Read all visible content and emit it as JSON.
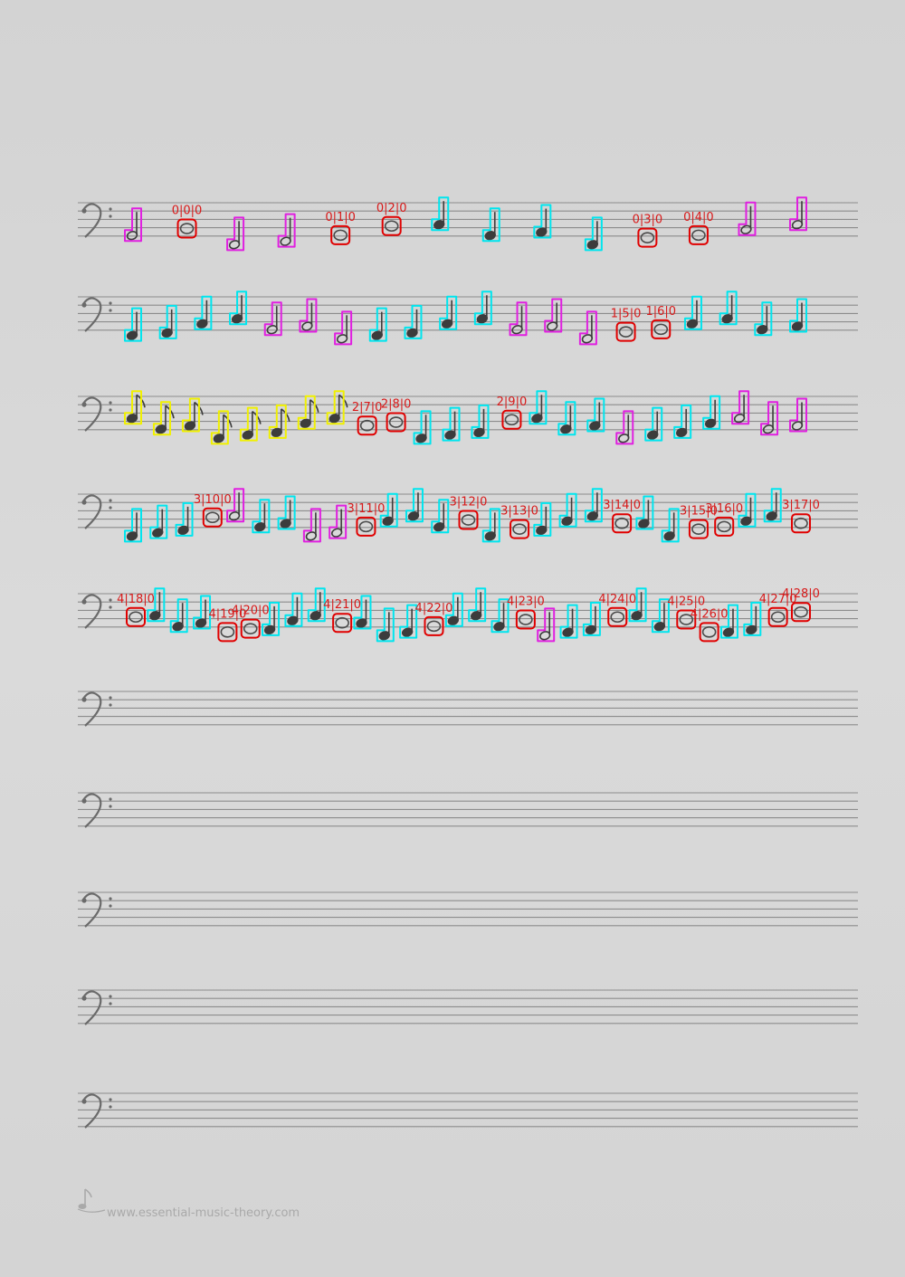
{
  "colors": {
    "paper": "#d6d6d6",
    "staff_line": "#8c8c8c",
    "note_ink": "#3c3c3c",
    "whole_box": "#e00000",
    "half_box": "#e020e0",
    "quarter_box": "#00e5ee",
    "eighth_box": "#f0f000",
    "label": "#d81a1a"
  },
  "footer": {
    "logo_icon": "eighth-note-icon",
    "url": "www.essential-music-theory.com"
  },
  "staves": [
    {
      "notes": [
        {
          "t": "half",
          "label": ""
        },
        {
          "t": "whole",
          "label": "0|0|0"
        },
        {
          "t": "half",
          "label": ""
        },
        {
          "t": "half",
          "label": ""
        },
        {
          "t": "whole",
          "label": "0|1|0"
        },
        {
          "t": "whole",
          "label": "0|2|0"
        },
        {
          "t": "quarter",
          "label": ""
        },
        {
          "t": "quarter",
          "label": ""
        },
        {
          "t": "quarter",
          "label": ""
        },
        {
          "t": "quarter",
          "label": ""
        },
        {
          "t": "whole",
          "label": "0|3|0"
        },
        {
          "t": "whole",
          "label": "0|4|0"
        },
        {
          "t": "half",
          "label": ""
        },
        {
          "t": "half",
          "label": ""
        }
      ]
    },
    {
      "notes": [
        {
          "t": "quarter",
          "label": ""
        },
        {
          "t": "quarter",
          "label": ""
        },
        {
          "t": "quarter",
          "label": ""
        },
        {
          "t": "quarter",
          "label": ""
        },
        {
          "t": "half",
          "label": ""
        },
        {
          "t": "half",
          "label": ""
        },
        {
          "t": "half",
          "label": ""
        },
        {
          "t": "quarter",
          "label": ""
        },
        {
          "t": "quarter",
          "label": ""
        },
        {
          "t": "quarter",
          "label": ""
        },
        {
          "t": "quarter",
          "label": ""
        },
        {
          "t": "half",
          "label": ""
        },
        {
          "t": "half",
          "label": ""
        },
        {
          "t": "half",
          "label": ""
        },
        {
          "t": "whole",
          "label": "1|5|0"
        },
        {
          "t": "whole",
          "label": "1|6|0"
        },
        {
          "t": "quarter",
          "label": ""
        },
        {
          "t": "quarter",
          "label": ""
        },
        {
          "t": "quarter",
          "label": ""
        },
        {
          "t": "quarter",
          "label": ""
        }
      ]
    },
    {
      "notes": [
        {
          "t": "eighth",
          "label": ""
        },
        {
          "t": "eighth",
          "label": ""
        },
        {
          "t": "eighth",
          "label": ""
        },
        {
          "t": "eighth",
          "label": ""
        },
        {
          "t": "eighth",
          "label": ""
        },
        {
          "t": "eighth",
          "label": ""
        },
        {
          "t": "eighth",
          "label": ""
        },
        {
          "t": "eighth",
          "label": ""
        },
        {
          "t": "whole",
          "label": "2|7|0"
        },
        {
          "t": "whole",
          "label": "2|8|0"
        },
        {
          "t": "quarter",
          "label": ""
        },
        {
          "t": "quarter",
          "label": ""
        },
        {
          "t": "quarter",
          "label": ""
        },
        {
          "t": "whole",
          "label": "2|9|0"
        },
        {
          "t": "quarter",
          "label": ""
        },
        {
          "t": "quarter",
          "label": ""
        },
        {
          "t": "quarter",
          "label": ""
        },
        {
          "t": "half",
          "label": ""
        },
        {
          "t": "quarter",
          "label": ""
        },
        {
          "t": "quarter",
          "label": ""
        },
        {
          "t": "quarter",
          "label": ""
        },
        {
          "t": "half",
          "label": ""
        },
        {
          "t": "half",
          "label": ""
        },
        {
          "t": "half",
          "label": ""
        }
      ]
    },
    {
      "notes": [
        {
          "t": "quarter",
          "label": ""
        },
        {
          "t": "quarter",
          "label": ""
        },
        {
          "t": "quarter",
          "label": ""
        },
        {
          "t": "whole",
          "label": "3|10|0"
        },
        {
          "t": "half",
          "label": ""
        },
        {
          "t": "quarter",
          "label": ""
        },
        {
          "t": "quarter",
          "label": ""
        },
        {
          "t": "half",
          "label": ""
        },
        {
          "t": "half",
          "label": ""
        },
        {
          "t": "whole",
          "label": "3|11|0"
        },
        {
          "t": "quarter",
          "label": ""
        },
        {
          "t": "quarter",
          "label": ""
        },
        {
          "t": "quarter",
          "label": ""
        },
        {
          "t": "whole",
          "label": "3|12|0"
        },
        {
          "t": "quarter",
          "label": ""
        },
        {
          "t": "whole",
          "label": "3|13|0"
        },
        {
          "t": "quarter",
          "label": ""
        },
        {
          "t": "quarter",
          "label": ""
        },
        {
          "t": "quarter",
          "label": ""
        },
        {
          "t": "whole",
          "label": "3|14|0"
        },
        {
          "t": "quarter",
          "label": ""
        },
        {
          "t": "quarter",
          "label": ""
        },
        {
          "t": "whole",
          "label": "3|15|0"
        },
        {
          "t": "whole",
          "label": "3|16|0"
        },
        {
          "t": "quarter",
          "label": ""
        },
        {
          "t": "quarter",
          "label": ""
        },
        {
          "t": "whole",
          "label": "3|17|0"
        }
      ]
    },
    {
      "notes": [
        {
          "t": "whole",
          "label": "4|18|0"
        },
        {
          "t": "quarter",
          "label": ""
        },
        {
          "t": "quarter",
          "label": ""
        },
        {
          "t": "quarter",
          "label": ""
        },
        {
          "t": "whole",
          "label": "4|19|0"
        },
        {
          "t": "whole",
          "label": "4|20|0"
        },
        {
          "t": "quarter",
          "label": ""
        },
        {
          "t": "quarter",
          "label": ""
        },
        {
          "t": "quarter",
          "label": ""
        },
        {
          "t": "whole",
          "label": "4|21|0"
        },
        {
          "t": "quarter",
          "label": ""
        },
        {
          "t": "quarter",
          "label": ""
        },
        {
          "t": "quarter",
          "label": ""
        },
        {
          "t": "whole",
          "label": "4|22|0"
        },
        {
          "t": "quarter",
          "label": ""
        },
        {
          "t": "quarter",
          "label": ""
        },
        {
          "t": "quarter",
          "label": ""
        },
        {
          "t": "whole",
          "label": "4|23|0"
        },
        {
          "t": "half",
          "label": ""
        },
        {
          "t": "quarter",
          "label": ""
        },
        {
          "t": "quarter",
          "label": ""
        },
        {
          "t": "whole",
          "label": "4|24|0"
        },
        {
          "t": "quarter",
          "label": ""
        },
        {
          "t": "quarter",
          "label": ""
        },
        {
          "t": "whole",
          "label": "4|25|0"
        },
        {
          "t": "whole",
          "label": "4|26|0"
        },
        {
          "t": "quarter",
          "label": ""
        },
        {
          "t": "quarter",
          "label": ""
        },
        {
          "t": "whole",
          "label": "4|27|0"
        },
        {
          "t": "whole",
          "label": "4|28|0"
        }
      ]
    },
    {
      "notes": []
    },
    {
      "notes": []
    },
    {
      "notes": []
    },
    {
      "notes": []
    },
    {
      "notes": []
    }
  ]
}
